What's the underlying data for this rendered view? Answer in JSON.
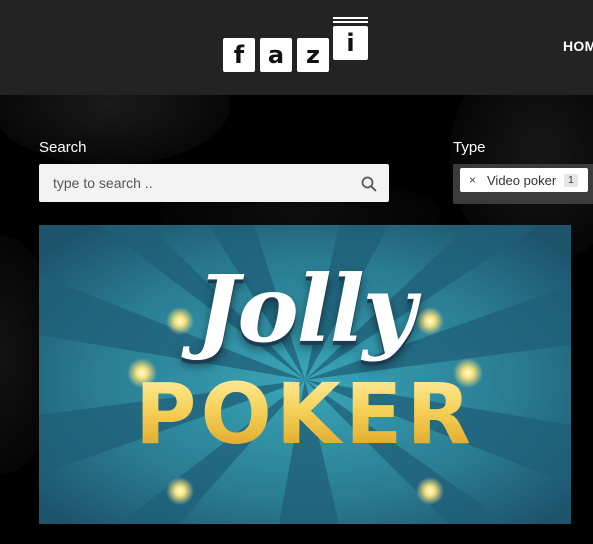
{
  "header": {
    "logo_letters": [
      "f",
      "a",
      "z",
      "i"
    ],
    "nav": {
      "home": "HOM"
    }
  },
  "search": {
    "label": "Search",
    "placeholder": "type to search .."
  },
  "type_filter": {
    "label": "Type",
    "selected": {
      "remove": "×",
      "label": "Video poker",
      "count": "1"
    }
  },
  "banner": {
    "title_script": "Jolly",
    "title_main": "POKER"
  },
  "colors": {
    "header_bg": "#232323",
    "page_bg": "#000000",
    "banner_teal": "#2e8ea3",
    "banner_gold": "#f3c63c"
  }
}
